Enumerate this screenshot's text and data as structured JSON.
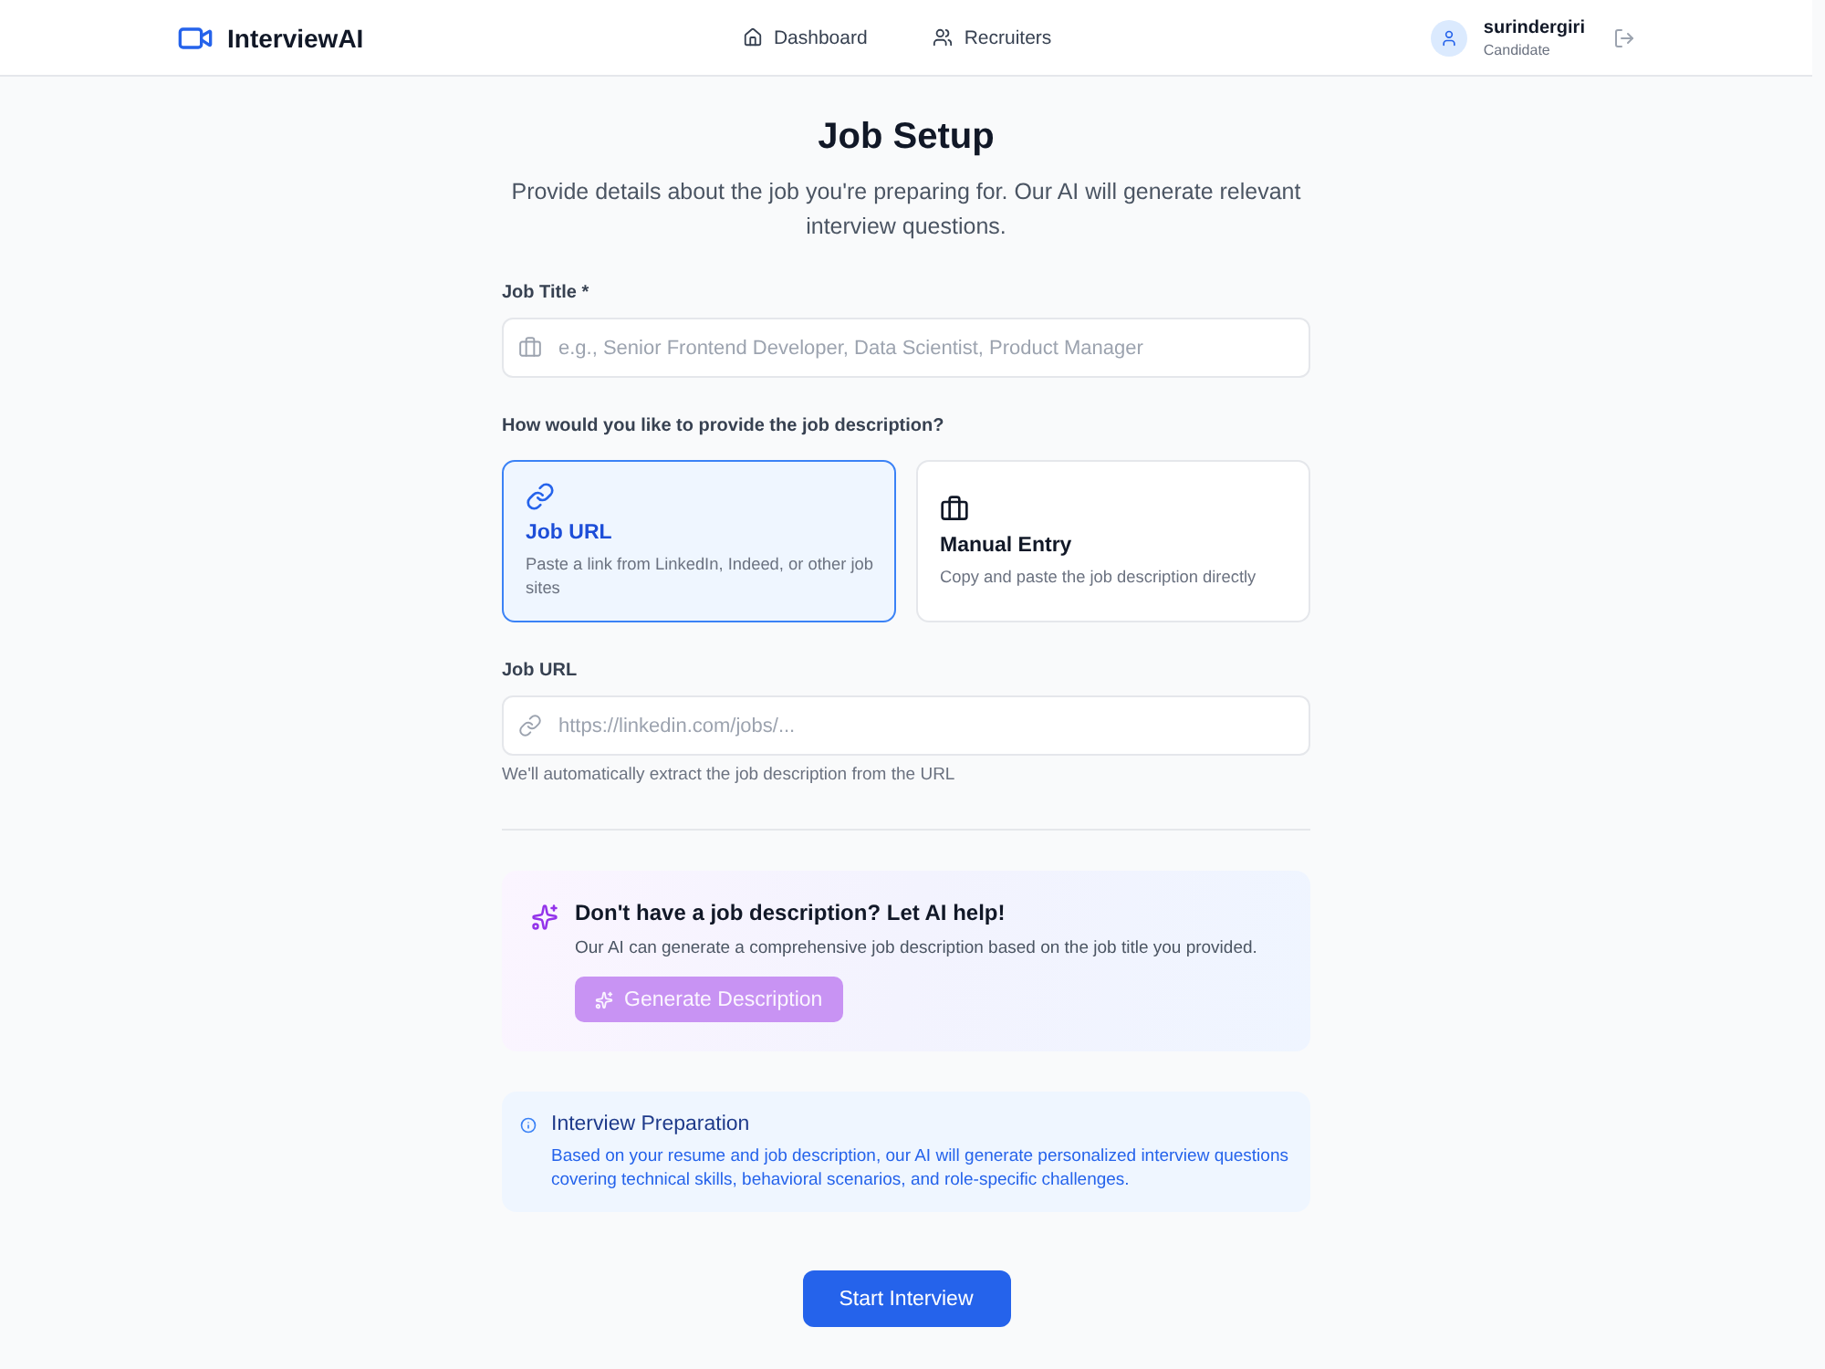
{
  "header": {
    "logo": "InterviewAI",
    "nav": [
      {
        "label": "Dashboard"
      },
      {
        "label": "Recruiters"
      }
    ],
    "user": {
      "name": "surindergiri",
      "role": "Candidate"
    }
  },
  "page": {
    "title": "Job Setup",
    "subtitle": "Provide details about the job you're preparing for. Our AI will generate relevant interview questions."
  },
  "job_title": {
    "label": "Job Title *",
    "placeholder": "e.g., Senior Frontend Developer, Data Scientist, Product Manager"
  },
  "description_source": {
    "question": "How would you like to provide the job description?",
    "options": [
      {
        "kind": "url",
        "title": "Job URL",
        "description": "Paste a link from LinkedIn, Indeed, or other job sites",
        "selected": true
      },
      {
        "kind": "manual",
        "title": "Manual Entry",
        "description": "Copy and paste the job description directly",
        "selected": false
      }
    ]
  },
  "job_url": {
    "label": "Job URL",
    "placeholder": "https://linkedin.com/jobs/...",
    "hint": "We'll automatically extract the job description from the URL"
  },
  "ai_help": {
    "title": "Don't have a job description? Let AI help!",
    "text": "Our AI can generate a comprehensive job description based on the job title you provided.",
    "button": {
      "label": "Generate Description",
      "disabled": true
    }
  },
  "info": {
    "title": "Interview Preparation",
    "text": "Based on your resume and job description, our AI will generate personalized interview questions covering technical skills, behavioral scenarios, and role-specific challenges."
  },
  "start_button": {
    "label": "Start Interview"
  }
}
